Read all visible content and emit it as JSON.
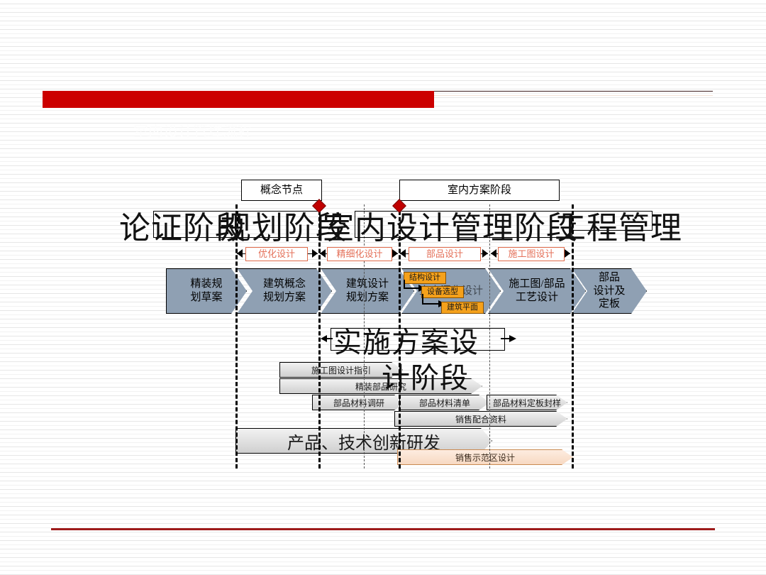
{
  "slide": {
    "title_ghost": "室内设计管理流程",
    "accent_color": "#cc0000",
    "footer_color": "#9e1b1b",
    "chevron_fill": "#8fa0b3",
    "orange_fill": "#f5a11b",
    "salmon_text": "#e4715a"
  },
  "callouts": [
    {
      "label": "概念节点"
    },
    {
      "label": "室内方案阶段"
    }
  ],
  "phase_boxes": [
    {
      "label": "论证阶段"
    },
    {
      "label": "规划阶段"
    },
    {
      "label": "室内设计管理阶段"
    },
    {
      "label": "工程管理"
    }
  ],
  "overlay_headings": [
    {
      "text": "论证阶段"
    },
    {
      "text": "规划阶段"
    },
    {
      "text": "室内设计管理阶段"
    },
    {
      "text": "工程管理"
    },
    {
      "text": "实施方案设"
    },
    {
      "text": "计阶段"
    }
  ],
  "span_labels": [
    {
      "label": "优化设计"
    },
    {
      "label": "精细化设计"
    },
    {
      "label": "部品设计"
    },
    {
      "label": "施工图设计"
    }
  ],
  "process_steps": [
    {
      "line1": "精装规",
      "line2": "划草案"
    },
    {
      "line1": "建筑概念",
      "line2": "规划方案"
    },
    {
      "line1": "建筑设计",
      "line2": "规划方案"
    },
    {
      "line1": "室内深化设计",
      "line2": ""
    },
    {
      "line1": "施工图/部品",
      "line2": "工艺设计"
    },
    {
      "line1": "部品",
      "line2": "设计及",
      "line3": "定板"
    }
  ],
  "orange_tags": [
    {
      "label": "结构设计"
    },
    {
      "label": "设备选型"
    },
    {
      "label": "建筑平面"
    }
  ],
  "task_bars": [
    {
      "label": "施工图设计指引"
    },
    {
      "label": "精装部品研究"
    },
    {
      "label": "部品材料调研"
    },
    {
      "label": "部品材料清单"
    },
    {
      "label": "部品材料定板封样"
    },
    {
      "label": "销售配合资料"
    },
    {
      "label": "产品、技术创新研发"
    },
    {
      "label": "销售示范区设计"
    }
  ]
}
